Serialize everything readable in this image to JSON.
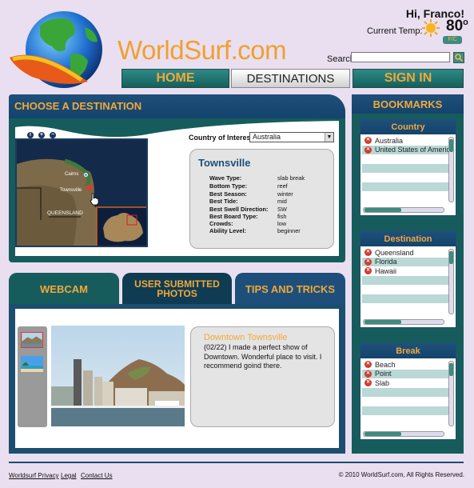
{
  "header": {
    "logo": "WorldSurf.com",
    "greeting": "Hi, Franco!",
    "temp_label": "Current Temp:",
    "temp_value": "80",
    "temp_degree": "o",
    "unit_toggle": "F/C",
    "search_label": "Search",
    "search_value": ""
  },
  "nav": {
    "home": "HOME",
    "destinations": "DESTINATIONS",
    "signin": "SIGN IN"
  },
  "destination": {
    "title": "CHOOSE A DESTINATION",
    "country_label": "Country of Interest:",
    "country_value": "Australia",
    "map_labels": {
      "cairns": "Cairns",
      "townsville": "Townsville",
      "queensland": "QUEENSLAND"
    },
    "info": {
      "name": "Townsville",
      "rows": [
        {
          "k": "Wave Type:",
          "v": "slab break"
        },
        {
          "k": "Bottom Type:",
          "v": "reef"
        },
        {
          "k": "Best Season:",
          "v": "winter"
        },
        {
          "k": "Best Tide:",
          "v": "mid"
        },
        {
          "k": "Best Swell Direction:",
          "v": "SW"
        },
        {
          "k": "Best Board Type:",
          "v": "fish"
        },
        {
          "k": "Crowds:",
          "v": "low"
        },
        {
          "k": "Ability Level:",
          "v": "beginner"
        }
      ]
    }
  },
  "bookmarks": {
    "title": "BOOKMARKS",
    "country": {
      "title": "Country",
      "items": [
        "Australia",
        "United States of America"
      ]
    },
    "destination": {
      "title": "Destination",
      "items": [
        "Queensland",
        "Florida",
        "Hawaii"
      ]
    },
    "break": {
      "title": "Break",
      "items": [
        "Beach",
        "Point",
        "Slab"
      ]
    }
  },
  "tabs": {
    "webcam": "WEBCAM",
    "user_photos_1": "USER SUBMITTED",
    "user_photos_2": "PHOTOS",
    "tips": "TIPS AND TRICKS"
  },
  "photo": {
    "title": "Downtown Townsville",
    "text": "(02/22) I made a perfect show of Downtown.  Wonderful place to visit.  I recommend goind there."
  },
  "footer": {
    "privacy": "Worldsurf Privacy",
    "legal": "Legal",
    "contact": "Contact Us",
    "copyright": "© 2010 WorldSurf.com, All Rights Reserved."
  },
  "colors": {
    "accent_orange": "#f2a83a",
    "teal": "#175c5c",
    "navy": "#1d4f7a",
    "background": "#e9dff0"
  }
}
